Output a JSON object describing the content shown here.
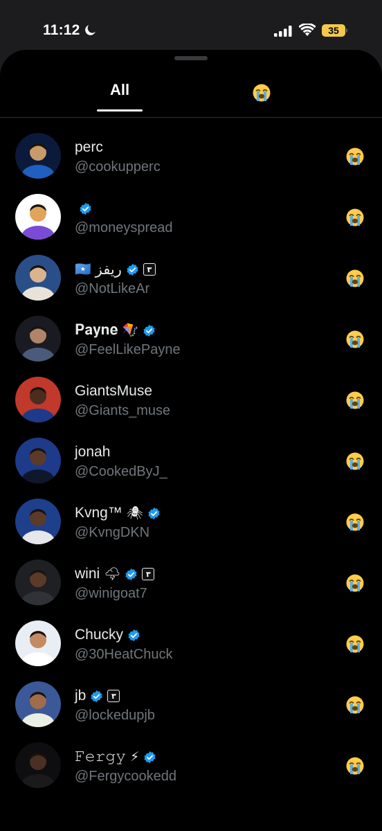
{
  "status_bar": {
    "time": "11:12",
    "battery": "35"
  },
  "tabs": [
    {
      "label": "All",
      "selected": true
    },
    {
      "label": "😭",
      "selected": false
    }
  ],
  "reaction_icon": "loudly-crying-face-icon",
  "users": [
    {
      "name": "perc",
      "handle": "@cookupperc",
      "verified": false,
      "affiliate": false,
      "emoji": ""
    },
    {
      "name": "",
      "handle": "@moneyspread",
      "verified": true,
      "affiliate": false,
      "emoji": ""
    },
    {
      "name": "ريفز",
      "handle": "@NotLikeAr",
      "verified": true,
      "affiliate": true,
      "emoji": "🇸🇴"
    },
    {
      "name": "𝐏𝐚𝐲𝐧𝐞",
      "handle": "@FeelLikePayne",
      "verified": true,
      "affiliate": false,
      "emoji": "🪁"
    },
    {
      "name": "GiantsMuse",
      "handle": "@Giants_muse",
      "verified": false,
      "affiliate": false,
      "emoji": ""
    },
    {
      "name": "jonah",
      "handle": "@CookedByJ_",
      "verified": false,
      "affiliate": false,
      "emoji": ""
    },
    {
      "name": "Kvng™",
      "handle": "@KvngDKN",
      "verified": true,
      "affiliate": false,
      "emoji": "🕷"
    },
    {
      "name": "wini",
      "handle": "@winigoat7",
      "verified": true,
      "affiliate": true,
      "emoji": "🌩"
    },
    {
      "name": "Chucky",
      "handle": "@30HeatChuck",
      "verified": true,
      "affiliate": false,
      "emoji": ""
    },
    {
      "name": "jb",
      "handle": "@lockedupjb",
      "verified": true,
      "affiliate": true,
      "emoji": ""
    },
    {
      "name": "𝙵𝚎𝚛𝚐𝚢",
      "handle": "@Fergycookedd",
      "verified": true,
      "affiliate": false,
      "emoji": "⚡"
    }
  ],
  "colors": {
    "verified": "#1d9bf0",
    "handle": "#71767b",
    "background": "#000000"
  }
}
